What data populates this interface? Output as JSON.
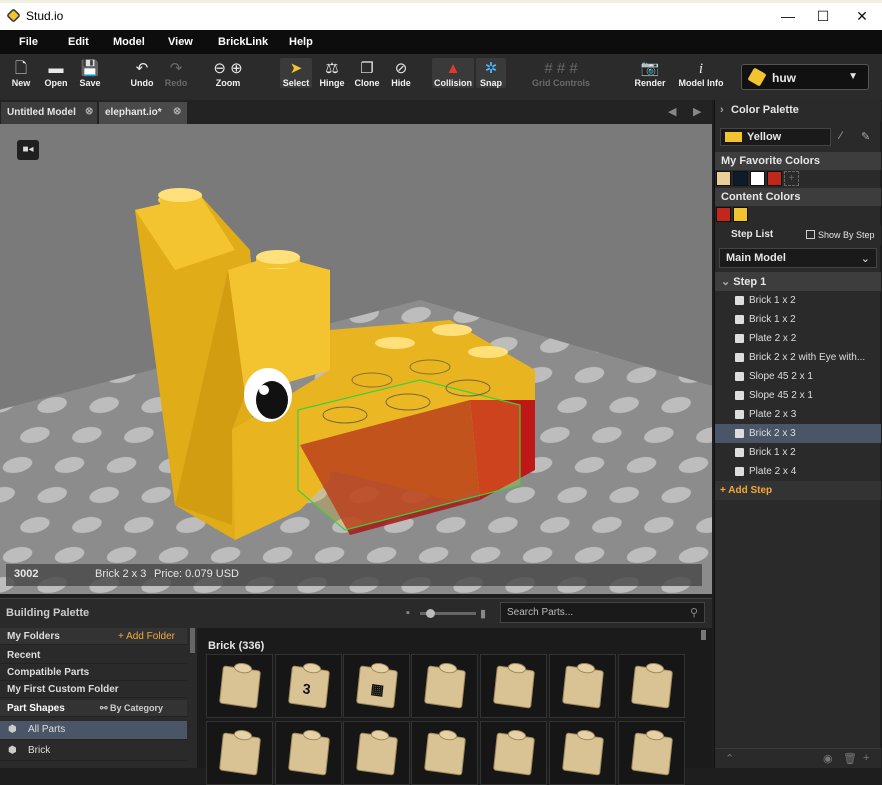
{
  "window": {
    "title": "Stud.io",
    "minimize": "—",
    "maximize": "☐",
    "close": "✕"
  },
  "menu": [
    "File",
    "Edit",
    "Model",
    "View",
    "BrickLink",
    "Help"
  ],
  "toolbar": [
    {
      "label": "New",
      "icon": "new-icon",
      "glyph": "🗋",
      "enabled": true
    },
    {
      "label": "Open",
      "icon": "open-icon",
      "glyph": "▬",
      "enabled": true
    },
    {
      "label": "Save",
      "icon": "save-icon",
      "glyph": "💾",
      "enabled": true
    },
    {
      "label": "Undo",
      "icon": "undo-icon",
      "glyph": "↶",
      "enabled": true
    },
    {
      "label": "Redo",
      "icon": "redo-icon",
      "glyph": "↷",
      "enabled": false
    },
    {
      "label": "Zoom",
      "icon": "zoom-icon",
      "glyph": "⊖ ⊕",
      "enabled": true
    },
    {
      "label": "Select",
      "icon": "select-icon",
      "glyph": "➤",
      "enabled": true
    },
    {
      "label": "Hinge",
      "icon": "hinge-icon",
      "glyph": "⚖",
      "enabled": true
    },
    {
      "label": "Clone",
      "icon": "clone-icon",
      "glyph": "❐",
      "enabled": true
    },
    {
      "label": "Hide",
      "icon": "hide-icon",
      "glyph": "⊘",
      "enabled": true
    },
    {
      "label": "Collision",
      "icon": "collision-icon",
      "glyph": "▲",
      "enabled": true
    },
    {
      "label": "Snap",
      "icon": "snap-icon",
      "glyph": "✲",
      "enabled": true
    },
    {
      "label": "Grid Controls",
      "icon": "grid-icon",
      "glyph": "# # #",
      "enabled": false
    },
    {
      "label": "Render",
      "icon": "camera-icon",
      "glyph": "📷",
      "enabled": true
    },
    {
      "label": "Model Info",
      "icon": "info-icon",
      "glyph": "i",
      "enabled": true
    }
  ],
  "user": {
    "name": "huw"
  },
  "tabs": [
    {
      "label": "Untitled Model"
    },
    {
      "label": "elephant.io*"
    }
  ],
  "tab_close": "⊗",
  "status": {
    "part_id": "3002",
    "part_name": "Brick 2 x 3",
    "price": "Price: 0.079 USD"
  },
  "color_palette": {
    "header": "Color Palette",
    "current_color": "Yellow",
    "current_hex": "#f4c430",
    "favorites_header": "My Favorite Colors",
    "favorites": [
      "#e8cf9a",
      "#0d1b2a",
      "#ffffff",
      "#c0281d",
      "#2a2a2a"
    ],
    "content_header": "Content Colors",
    "content": [
      "#c0281d",
      "#f4c430"
    ]
  },
  "step_list": {
    "header": "Step List",
    "show_by_step": "Show By Step",
    "model_select": "Main Model",
    "step_title": "Step 1",
    "items": [
      "Brick 1 x 2",
      "Brick 1 x 2",
      "Plate 2 x 2",
      "Brick 2 x 2 with Eye with...",
      "Slope 45 2 x 1",
      "Slope 45 2 x 1",
      "Plate 2 x 3",
      "Brick 2 x 3",
      "Brick 1 x 2",
      "Plate 2 x 4"
    ],
    "selected": "Brick 2 x 3",
    "add_step": "Add Step"
  },
  "building_palette": {
    "header": "Building Palette",
    "search_placeholder": "Search Parts...",
    "folders": {
      "title": "My Folders",
      "add": "Add Folder",
      "items": [
        "Recent",
        "Compatible Parts",
        "My First Custom Folder"
      ]
    },
    "shapes": {
      "title": "Part Shapes",
      "by": "By Category",
      "items": [
        "All Parts",
        "Brick"
      ]
    },
    "category": "Brick (336)"
  }
}
